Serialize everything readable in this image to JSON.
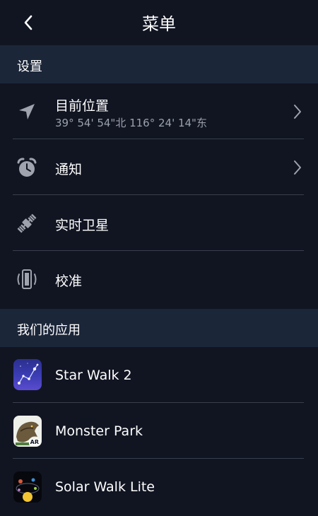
{
  "header": {
    "title": "菜单"
  },
  "settings": {
    "section_label": "设置",
    "items": [
      {
        "label": "目前位置",
        "sublabel": "39° 54' 54\"北 116° 24' 14\"东"
      },
      {
        "label": "通知"
      },
      {
        "label": "实时卫星"
      },
      {
        "label": "校准"
      }
    ]
  },
  "apps": {
    "section_label": "我们的应用",
    "items": [
      {
        "label": "Star Walk 2"
      },
      {
        "label": "Monster Park",
        "badge": "AR"
      },
      {
        "label": "Solar Walk Lite"
      }
    ]
  },
  "colors": {
    "background": "#111522",
    "section": "#1c2639",
    "icon": "#9ea3ad",
    "divider": "#3a3f4d"
  }
}
